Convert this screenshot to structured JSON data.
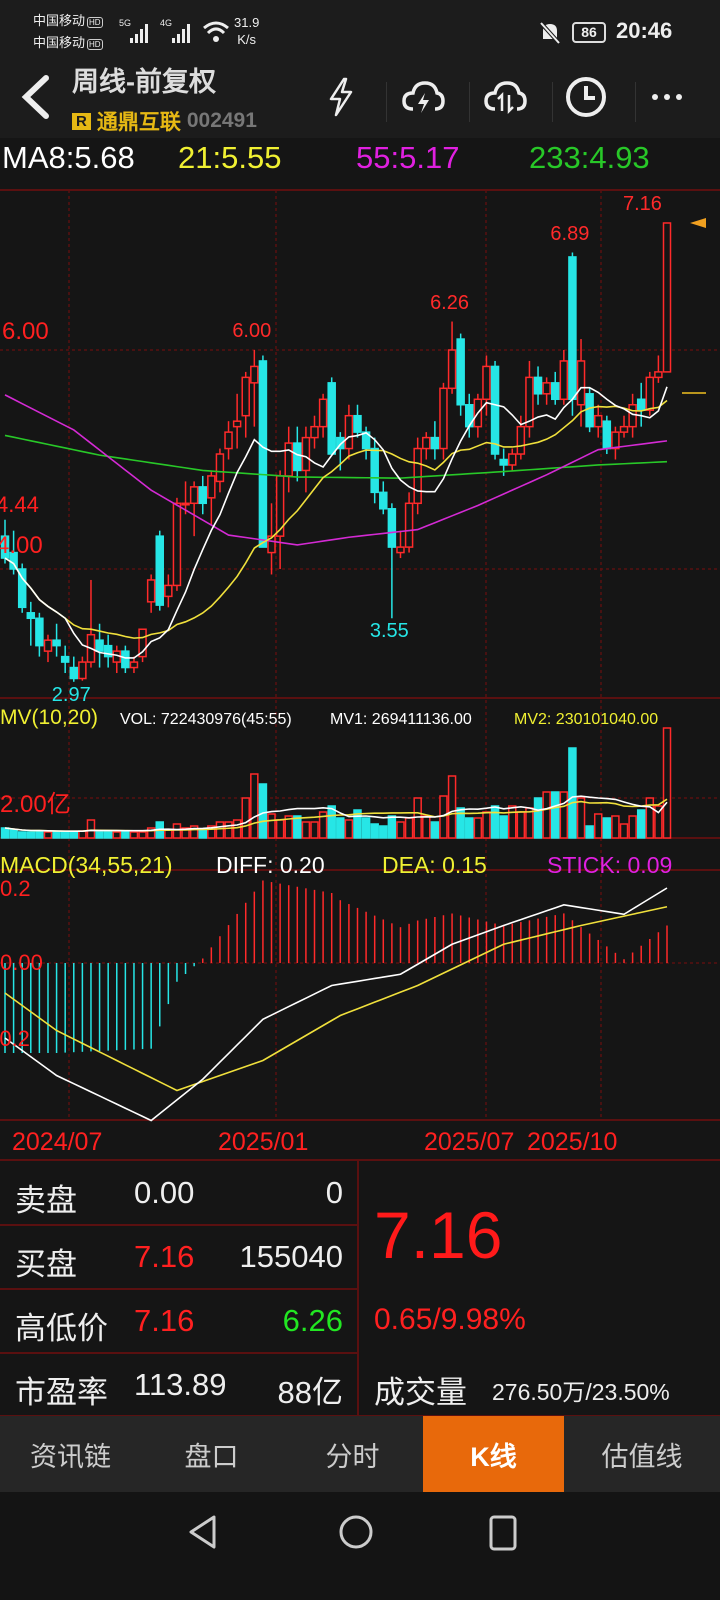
{
  "status": {
    "carrier1": "中国移动",
    "carrier2": "中国移动",
    "hd": "HD",
    "net1": "5G",
    "net2": "4G",
    "speed_value": "31.9",
    "speed_unit": "K/s",
    "battery": "86",
    "time": "20:46"
  },
  "header": {
    "title": "周线-前复权",
    "badge": "R",
    "stock_name": "通鼎互联",
    "stock_code": "002491"
  },
  "ma": {
    "ma8": "MA8:5.68",
    "ma21": "21:5.55",
    "ma55": "55:5.17",
    "ma233": "233:4.93"
  },
  "colors": {
    "up": "#ff2a2a",
    "down": "#26e6e6",
    "ma8": "#ffffff",
    "ma21": "#f0e03c",
    "ma55": "#d42ad4",
    "ma233": "#28c828",
    "grid": "#5a1010",
    "accent": "#e8690b"
  },
  "chart_data": {
    "type": "candlestick",
    "title": "周线-前复权",
    "price_ticks": [
      "6.00",
      "4.00"
    ],
    "price_tick_values": [
      6.0,
      4.0
    ],
    "left_edge_label": "4.44",
    "annotations": [
      {
        "text": "6.00",
        "index": 29,
        "value": 6.0,
        "kind": "high"
      },
      {
        "text": "2.97",
        "index": 8,
        "value": 2.97,
        "kind": "low"
      },
      {
        "text": "3.55",
        "index": 45,
        "value": 3.55,
        "kind": "low"
      },
      {
        "text": "6.26",
        "index": 52,
        "value": 6.26,
        "kind": "high"
      },
      {
        "text": "6.89",
        "index": 66,
        "value": 6.89,
        "kind": "high"
      },
      {
        "text": "7.16",
        "index": 77,
        "value": 7.16,
        "kind": "high"
      }
    ],
    "ohlc": [
      [
        4.3,
        4.45,
        4.05,
        4.1
      ],
      [
        4.15,
        4.35,
        3.95,
        4.0
      ],
      [
        4.0,
        4.05,
        3.6,
        3.65
      ],
      [
        3.6,
        3.7,
        3.3,
        3.55
      ],
      [
        3.55,
        3.6,
        3.2,
        3.3
      ],
      [
        3.25,
        3.4,
        3.15,
        3.35
      ],
      [
        3.35,
        3.5,
        3.2,
        3.3
      ],
      [
        3.2,
        3.3,
        3.05,
        3.15
      ],
      [
        3.1,
        3.2,
        2.97,
        3.0
      ],
      [
        3.0,
        3.2,
        2.98,
        3.15
      ],
      [
        3.15,
        3.9,
        3.1,
        3.4
      ],
      [
        3.35,
        3.5,
        3.1,
        3.25
      ],
      [
        3.3,
        3.4,
        3.1,
        3.2
      ],
      [
        3.15,
        3.3,
        3.05,
        3.25
      ],
      [
        3.25,
        3.3,
        3.05,
        3.1
      ],
      [
        3.1,
        3.2,
        3.05,
        3.15
      ],
      [
        3.2,
        3.45,
        3.15,
        3.45
      ],
      [
        3.7,
        3.95,
        3.6,
        3.9
      ],
      [
        4.3,
        4.35,
        3.62,
        3.67
      ],
      [
        3.75,
        3.95,
        3.65,
        3.85
      ],
      [
        3.85,
        4.65,
        3.8,
        4.6
      ],
      [
        4.6,
        4.8,
        4.5,
        4.6
      ],
      [
        4.6,
        4.8,
        4.3,
        4.75
      ],
      [
        4.75,
        4.85,
        4.5,
        4.6
      ],
      [
        4.65,
        4.9,
        4.4,
        4.85
      ],
      [
        4.8,
        5.1,
        4.7,
        5.05
      ],
      [
        5.1,
        5.35,
        5.0,
        5.25
      ],
      [
        5.3,
        5.6,
        5.1,
        5.35
      ],
      [
        5.4,
        5.8,
        5.2,
        5.75
      ],
      [
        5.7,
        6.0,
        5.3,
        5.85
      ],
      [
        5.9,
        5.95,
        4.2,
        4.2
      ],
      [
        4.15,
        4.6,
        3.95,
        4.3
      ],
      [
        4.3,
        4.9,
        4.0,
        4.85
      ],
      [
        4.85,
        5.3,
        4.7,
        5.15
      ],
      [
        5.15,
        5.3,
        4.8,
        4.9
      ],
      [
        4.9,
        5.3,
        4.7,
        5.2
      ],
      [
        5.2,
        5.4,
        5.1,
        5.3
      ],
      [
        5.3,
        5.6,
        5.2,
        5.55
      ],
      [
        5.7,
        5.75,
        5.05,
        5.05
      ],
      [
        5.2,
        5.25,
        4.9,
        5.1
      ],
      [
        5.1,
        5.5,
        5.0,
        5.4
      ],
      [
        5.4,
        5.5,
        5.2,
        5.25
      ],
      [
        5.25,
        5.3,
        5.0,
        5.1
      ],
      [
        5.1,
        5.2,
        4.6,
        4.7
      ],
      [
        4.7,
        4.8,
        4.5,
        4.55
      ],
      [
        4.55,
        4.6,
        3.55,
        4.2
      ],
      [
        4.15,
        4.35,
        4.1,
        4.2
      ],
      [
        4.2,
        4.7,
        4.15,
        4.6
      ],
      [
        4.6,
        5.2,
        4.5,
        5.1
      ],
      [
        5.1,
        5.25,
        5.0,
        5.2
      ],
      [
        5.2,
        5.35,
        5.0,
        5.1
      ],
      [
        5.1,
        5.7,
        5.0,
        5.65
      ],
      [
        5.65,
        6.26,
        5.6,
        6.0
      ],
      [
        6.1,
        6.15,
        5.4,
        5.5
      ],
      [
        5.5,
        5.6,
        5.2,
        5.3
      ],
      [
        5.3,
        5.6,
        5.2,
        5.55
      ],
      [
        5.55,
        5.95,
        5.4,
        5.85
      ],
      [
        5.85,
        5.9,
        5.0,
        5.05
      ],
      [
        5.0,
        5.1,
        4.85,
        4.95
      ],
      [
        4.95,
        5.1,
        4.9,
        5.05
      ],
      [
        5.05,
        5.4,
        5.0,
        5.3
      ],
      [
        5.3,
        5.9,
        5.2,
        5.75
      ],
      [
        5.75,
        5.85,
        5.5,
        5.6
      ],
      [
        5.6,
        5.75,
        5.5,
        5.7
      ],
      [
        5.7,
        5.8,
        5.5,
        5.55
      ],
      [
        5.55,
        6.0,
        5.5,
        5.9
      ],
      [
        6.85,
        6.89,
        5.4,
        5.55
      ],
      [
        5.5,
        6.1,
        5.3,
        5.9
      ],
      [
        5.6,
        5.65,
        5.25,
        5.3
      ],
      [
        5.3,
        5.5,
        5.2,
        5.4
      ],
      [
        5.35,
        5.4,
        5.05,
        5.1
      ],
      [
        5.1,
        5.3,
        5.0,
        5.25
      ],
      [
        5.25,
        5.4,
        5.2,
        5.3
      ],
      [
        5.3,
        5.6,
        5.2,
        5.5
      ],
      [
        5.55,
        5.7,
        5.3,
        5.45
      ],
      [
        5.45,
        5.8,
        5.4,
        5.75
      ],
      [
        5.75,
        5.95,
        5.7,
        5.8
      ],
      [
        5.8,
        7.16,
        5.8,
        7.16
      ]
    ],
    "ma55_points": [
      [
        0,
        5.59
      ],
      [
        8,
        5.27
      ],
      [
        17,
        4.72
      ],
      [
        26,
        4.31
      ],
      [
        34,
        4.22
      ],
      [
        40,
        4.29
      ],
      [
        48,
        4.36
      ],
      [
        55,
        4.58
      ],
      [
        63,
        4.86
      ],
      [
        69,
        5.09
      ],
      [
        77,
        5.17
      ]
    ],
    "ma233_points": [
      [
        0,
        5.22
      ],
      [
        11,
        5.04
      ],
      [
        23,
        4.9
      ],
      [
        34,
        4.84
      ],
      [
        46,
        4.83
      ],
      [
        58,
        4.89
      ],
      [
        69,
        4.95
      ],
      [
        77,
        4.98
      ]
    ],
    "volume_title": "MV(10,20)",
    "volume_readout": {
      "vol": "VOL: 722430976(45:55)",
      "mv1": "MV1: 269411136.00",
      "mv2": "MV2: 230101040.00"
    },
    "volume_tick": "2.00亿",
    "volume_unit": "亿",
    "volumes": [
      0.5,
      0.4,
      0.3,
      0.3,
      0.35,
      0.3,
      0.3,
      0.3,
      0.3,
      0.35,
      0.9,
      0.3,
      0.3,
      0.3,
      0.3,
      0.3,
      0.3,
      0.5,
      0.8,
      0.4,
      0.7,
      0.5,
      0.6,
      0.4,
      0.6,
      0.8,
      0.8,
      0.9,
      2.0,
      3.2,
      2.7,
      1.2,
      0.9,
      1.1,
      1.1,
      0.8,
      0.8,
      1.3,
      1.6,
      1.0,
      0.9,
      1.4,
      1.0,
      0.7,
      0.6,
      1.1,
      0.8,
      1.0,
      2.0,
      1.1,
      0.8,
      2.1,
      3.1,
      1.5,
      1.0,
      1.0,
      1.3,
      1.6,
      1.1,
      1.6,
      1.3,
      1.5,
      2.0,
      2.3,
      2.3,
      2.3,
      4.5,
      2.0,
      0.6,
      1.2,
      1.0,
      1.1,
      0.7,
      1.1,
      1.4,
      2.0,
      1.6,
      7.2
    ],
    "macd_title": "MACD(34,55,21)",
    "macd_readout": {
      "diff": "DIFF: 0.20",
      "dea": "DEA: 0.15",
      "stick": "STICK: 0.09"
    },
    "macd_ticks": [
      "0.2",
      "0.00",
      "-0.2"
    ],
    "macd_tick_values": [
      0.2,
      0.0,
      -0.2
    ],
    "diff_points": [
      [
        0,
        -0.2
      ],
      [
        6,
        -0.3
      ],
      [
        17,
        -0.42
      ],
      [
        23,
        -0.31
      ],
      [
        30,
        -0.15
      ],
      [
        38,
        -0.06
      ],
      [
        46,
        -0.03
      ],
      [
        52,
        0.05
      ],
      [
        58,
        0.1
      ],
      [
        65,
        0.155
      ],
      [
        72,
        0.13
      ],
      [
        77,
        0.2
      ]
    ],
    "dea_points": [
      [
        0,
        -0.08
      ],
      [
        6,
        -0.18
      ],
      [
        20,
        -0.34
      ],
      [
        30,
        -0.26
      ],
      [
        39,
        -0.14
      ],
      [
        48,
        -0.06
      ],
      [
        58,
        0.05
      ],
      [
        67,
        0.1
      ],
      [
        77,
        0.15
      ]
    ],
    "x_labels": [
      "2024/07",
      "2025/01",
      "2025/07",
      "2025/10"
    ]
  },
  "quote": {
    "sell_label": "卖盘",
    "sell_price": "0.00",
    "sell_qty": "0",
    "buy_label": "买盘",
    "buy_price": "7.16",
    "buy_qty": "155040",
    "hl_label": "高低价",
    "high": "7.16",
    "low": "6.26",
    "pe_label": "市盈率",
    "pe": "113.89",
    "mcap": "88亿",
    "price": "7.16",
    "change": "0.65/9.98%",
    "vol_label": "成交量",
    "vol_value": "276.50万/23.50%"
  },
  "tabs": [
    {
      "label": "资讯链"
    },
    {
      "label": "盘口"
    },
    {
      "label": "分时"
    },
    {
      "label": "K线",
      "active": true
    },
    {
      "label": "估值线"
    }
  ]
}
